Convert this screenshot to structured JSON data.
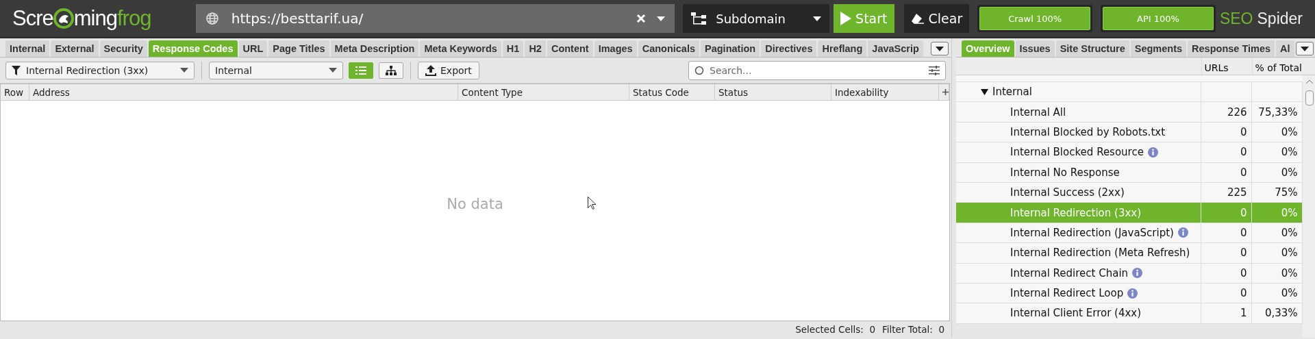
{
  "logo": {
    "before": "Scre",
    "after": "ming",
    "accent": "frog"
  },
  "url_field": {
    "value": "https://besttarif.ua/"
  },
  "mode_dropdown": {
    "value": "Subdomain"
  },
  "buttons": [
    {
      "kind": "start",
      "label": "Start"
    },
    {
      "kind": "clear",
      "label": "Clear"
    }
  ],
  "progress": [
    {
      "label": "Crawl 100%",
      "level": 1
    },
    {
      "label": "API 100%",
      "level": 1
    }
  ],
  "brand": {
    "accent": "SEO",
    "rest": "Spider"
  },
  "left_tabs": [
    {
      "label": "Internal",
      "selected": false
    },
    {
      "label": "External",
      "selected": false
    },
    {
      "label": "Security",
      "selected": false
    },
    {
      "label": "Response Codes",
      "selected": true
    },
    {
      "label": "URL",
      "selected": false
    },
    {
      "label": "Page Titles",
      "selected": false
    },
    {
      "label": "Meta Description",
      "selected": false
    },
    {
      "label": "Meta Keywords",
      "selected": false
    },
    {
      "label": "H1",
      "selected": false
    },
    {
      "label": "H2",
      "selected": false
    },
    {
      "label": "Content",
      "selected": false
    },
    {
      "label": "Images",
      "selected": false
    },
    {
      "label": "Canonicals",
      "selected": false
    },
    {
      "label": "Pagination",
      "selected": false
    },
    {
      "label": "Directives",
      "selected": false
    },
    {
      "label": "Hreflang",
      "selected": false
    },
    {
      "label": "JavaScrip",
      "selected": false
    }
  ],
  "toolbar": {
    "filter": "Internal Redirection (3xx)",
    "scope": "Internal",
    "views": [
      {
        "kind": "list",
        "selected": true
      },
      {
        "kind": "tree",
        "selected": false
      }
    ],
    "export": "Export",
    "search": {
      "placeholder": "Search..."
    }
  },
  "table": {
    "columns": [
      "Row",
      "Address",
      "Content Type",
      "Status Code",
      "Status",
      "Indexability"
    ],
    "empty_message": "No data"
  },
  "status_bar": {
    "selected_cells": "Selected Cells:  0",
    "filter_total": "Filter Total:  0"
  },
  "right_tabs": [
    {
      "label": "Overview",
      "selected": true
    },
    {
      "label": "Issues",
      "selected": false
    },
    {
      "label": "Site Structure",
      "selected": false
    },
    {
      "label": "Segments",
      "selected": false
    },
    {
      "label": "Response Times",
      "selected": false
    },
    {
      "label": "Al",
      "selected": false
    }
  ],
  "overview": {
    "columns": [
      "URLs",
      "% of Total"
    ],
    "rows": [
      {
        "kind": "group",
        "label": "Internal",
        "expanded": true
      },
      {
        "kind": "item",
        "label": "Internal All",
        "info": false,
        "urls": "226",
        "percent": "75,33%",
        "selected": false
      },
      {
        "kind": "item",
        "label": "Internal Blocked by Robots.txt",
        "info": false,
        "urls": "0",
        "percent": "0%",
        "selected": false
      },
      {
        "kind": "item",
        "label": "Internal Blocked Resource",
        "info": true,
        "urls": "0",
        "percent": "0%",
        "selected": false
      },
      {
        "kind": "item",
        "label": "Internal No Response",
        "info": false,
        "urls": "0",
        "percent": "0%",
        "selected": false
      },
      {
        "kind": "item",
        "label": "Internal Success (2xx)",
        "info": false,
        "urls": "225",
        "percent": "75%",
        "selected": false
      },
      {
        "kind": "item",
        "label": "Internal Redirection (3xx)",
        "info": false,
        "urls": "0",
        "percent": "0%",
        "selected": true
      },
      {
        "kind": "item",
        "label": "Internal Redirection (JavaScript)",
        "info": true,
        "urls": "0",
        "percent": "0%",
        "selected": false
      },
      {
        "kind": "item",
        "label": "Internal Redirection (Meta Refresh)",
        "info": false,
        "urls": "0",
        "percent": "0%",
        "selected": false
      },
      {
        "kind": "item",
        "label": "Internal Redirect Chain",
        "info": true,
        "urls": "0",
        "percent": "0%",
        "selected": false
      },
      {
        "kind": "item",
        "label": "Internal Redirect Loop",
        "info": true,
        "urls": "0",
        "percent": "0%",
        "selected": false
      },
      {
        "kind": "item",
        "label": "Internal Client Error (4xx)",
        "info": false,
        "urls": "1",
        "percent": "0,33%",
        "selected": false
      }
    ]
  }
}
